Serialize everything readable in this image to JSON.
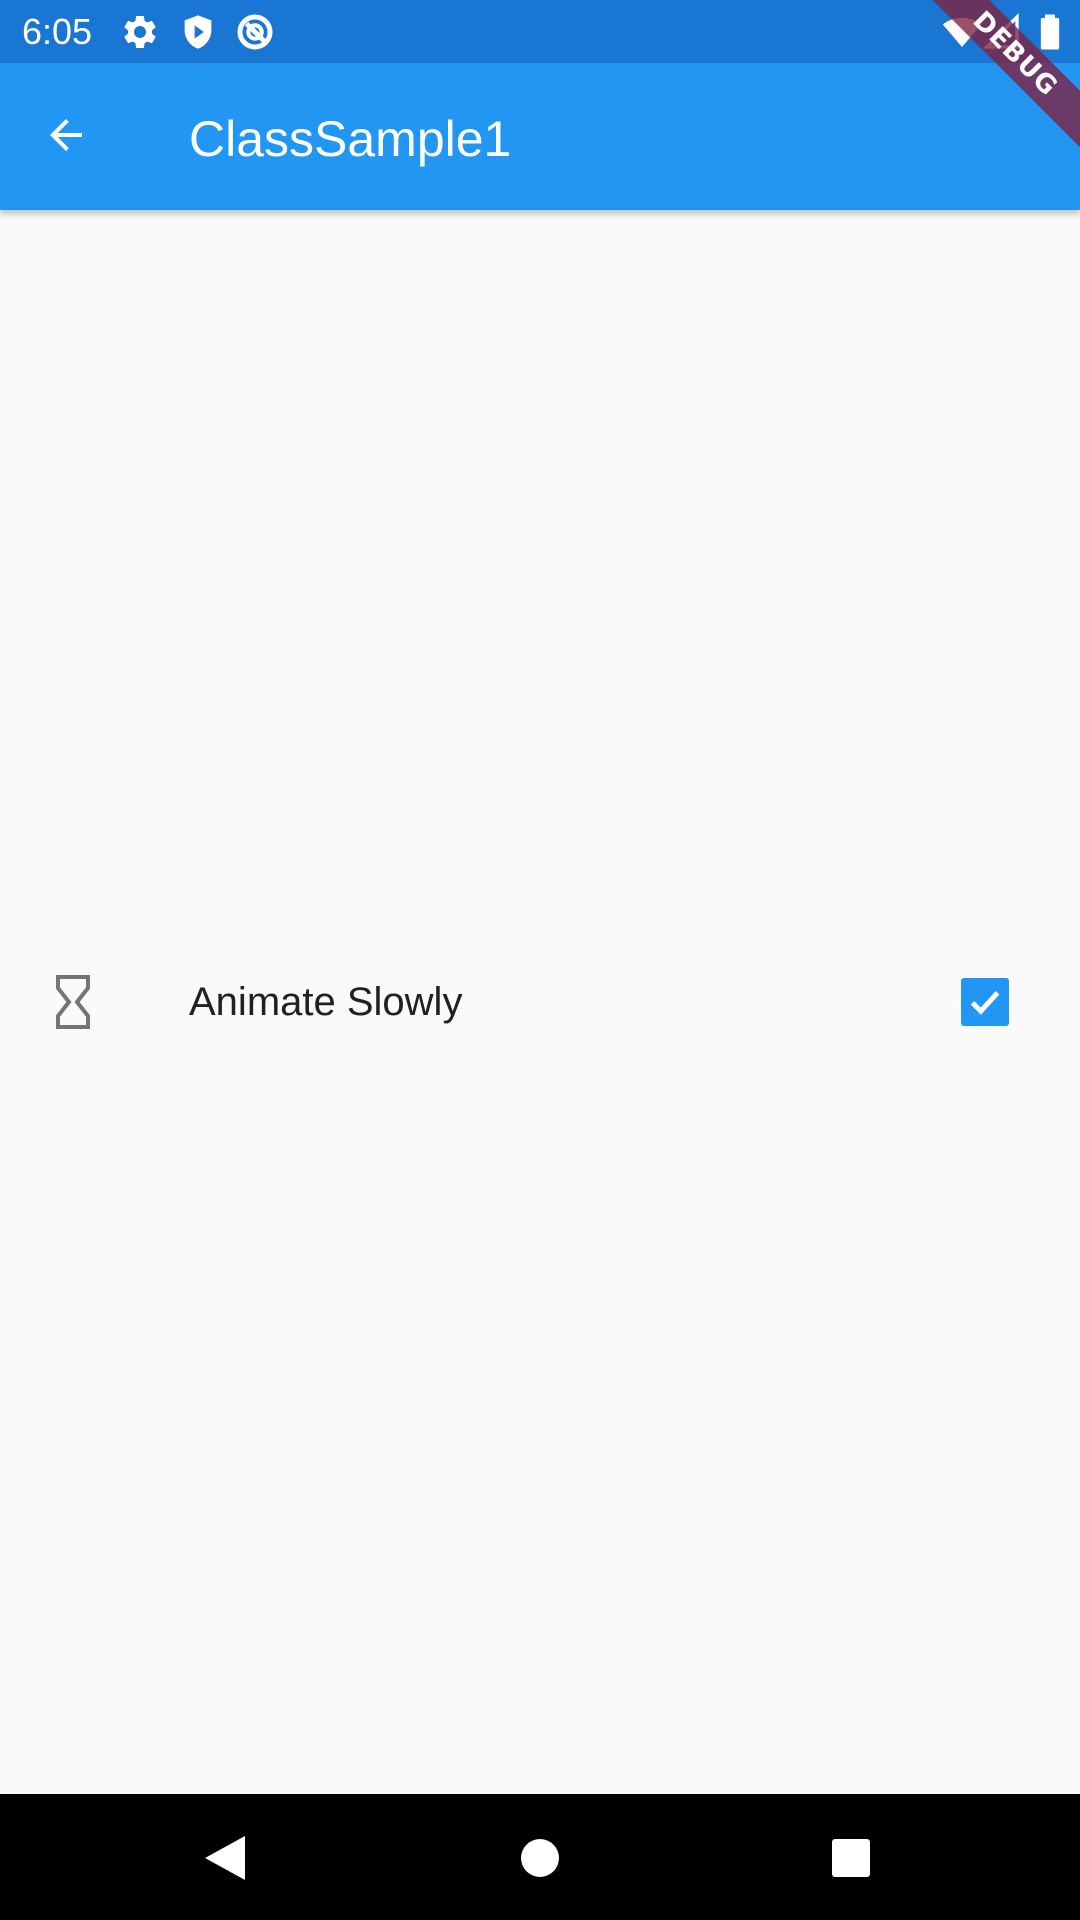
{
  "status_bar": {
    "time": "6:05",
    "icons_left": [
      "settings-icon",
      "play-shield-icon",
      "circle-slash-icon"
    ],
    "icons_right": [
      "wifi-icon",
      "cellular-signal-icon",
      "battery-icon"
    ],
    "background": "#1976d2"
  },
  "app_bar": {
    "title": "ClassSample1",
    "back_icon": "arrow-back-icon",
    "background": "#2196f3"
  },
  "debug_banner": {
    "label": "DEBUG"
  },
  "list_tile": {
    "leading_icon": "hourglass-icon",
    "title": "Animate Slowly",
    "checked": true,
    "accent": "#2196f3"
  },
  "navigation_bar": {
    "buttons": [
      "back-triangle-icon",
      "home-circle-icon",
      "recents-square-icon"
    ]
  }
}
